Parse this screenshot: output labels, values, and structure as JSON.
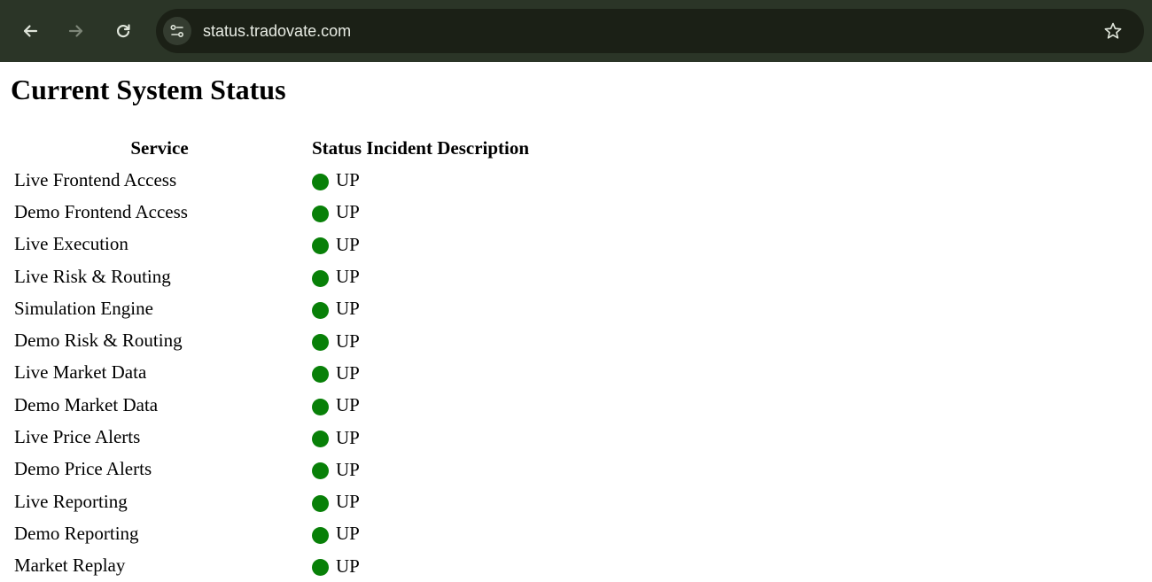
{
  "browser": {
    "url": "status.tradovate.com"
  },
  "page": {
    "title": "Current System Status",
    "table": {
      "headers": {
        "service": "Service",
        "status": "Status",
        "incident": "Incident Description"
      },
      "rows": [
        {
          "service": "Live Frontend Access",
          "status": "UP",
          "status_color": "#088008"
        },
        {
          "service": "Demo Frontend Access",
          "status": "UP",
          "status_color": "#088008"
        },
        {
          "service": "Live Execution",
          "status": "UP",
          "status_color": "#088008"
        },
        {
          "service": "Live Risk & Routing",
          "status": "UP",
          "status_color": "#088008"
        },
        {
          "service": "Simulation Engine",
          "status": "UP",
          "status_color": "#088008"
        },
        {
          "service": "Demo Risk & Routing",
          "status": "UP",
          "status_color": "#088008"
        },
        {
          "service": "Live Market Data",
          "status": "UP",
          "status_color": "#088008"
        },
        {
          "service": "Demo Market Data",
          "status": "UP",
          "status_color": "#088008"
        },
        {
          "service": "Live Price Alerts",
          "status": "UP",
          "status_color": "#088008"
        },
        {
          "service": "Demo Price Alerts",
          "status": "UP",
          "status_color": "#088008"
        },
        {
          "service": "Live Reporting",
          "status": "UP",
          "status_color": "#088008"
        },
        {
          "service": "Demo Reporting",
          "status": "UP",
          "status_color": "#088008"
        },
        {
          "service": "Market Replay",
          "status": "UP",
          "status_color": "#088008"
        }
      ]
    }
  },
  "icons": {
    "back": "arrow-left-icon",
    "forward": "arrow-right-icon",
    "reload": "reload-icon",
    "site_info": "tune-icon",
    "bookmark": "star-icon"
  }
}
